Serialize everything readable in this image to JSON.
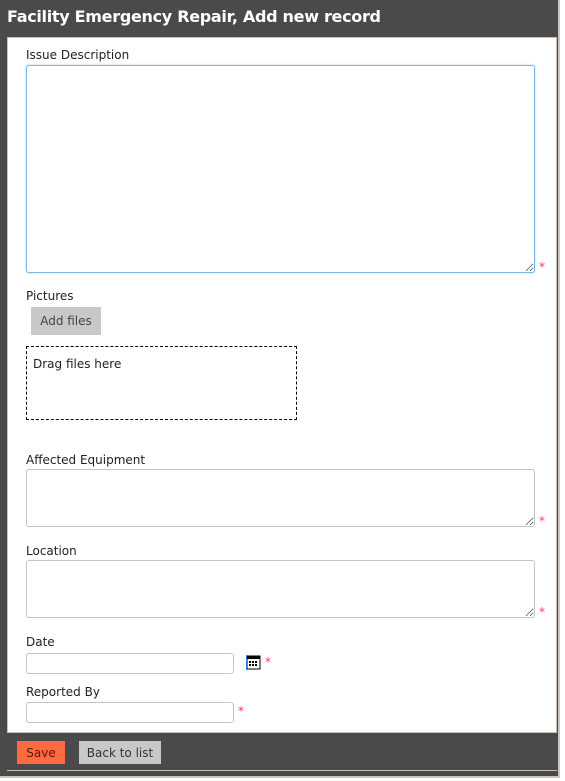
{
  "header": {
    "title": "Facility Emergency Repair, Add new record"
  },
  "form": {
    "issue_description": {
      "label": "Issue Description",
      "value": "",
      "required_marker": "*"
    },
    "pictures": {
      "label": "Pictures",
      "add_files_label": "Add files",
      "dropzone_text": "Drag files here"
    },
    "affected_equipment": {
      "label": "Affected Equipment",
      "value": "",
      "required_marker": "*"
    },
    "location": {
      "label": "Location",
      "value": "",
      "required_marker": "*"
    },
    "date": {
      "label": "Date",
      "value": "",
      "icon": "calendar-icon",
      "required_marker": "*"
    },
    "reported_by": {
      "label": "Reported By",
      "value": "",
      "required_marker": "*"
    }
  },
  "footer": {
    "save_label": "Save",
    "back_label": "Back to list"
  },
  "colors": {
    "frame": "#4a4a4a",
    "save": "#ff6a40",
    "required": "#ff3b5c",
    "focus_border": "#7fb7e3"
  }
}
